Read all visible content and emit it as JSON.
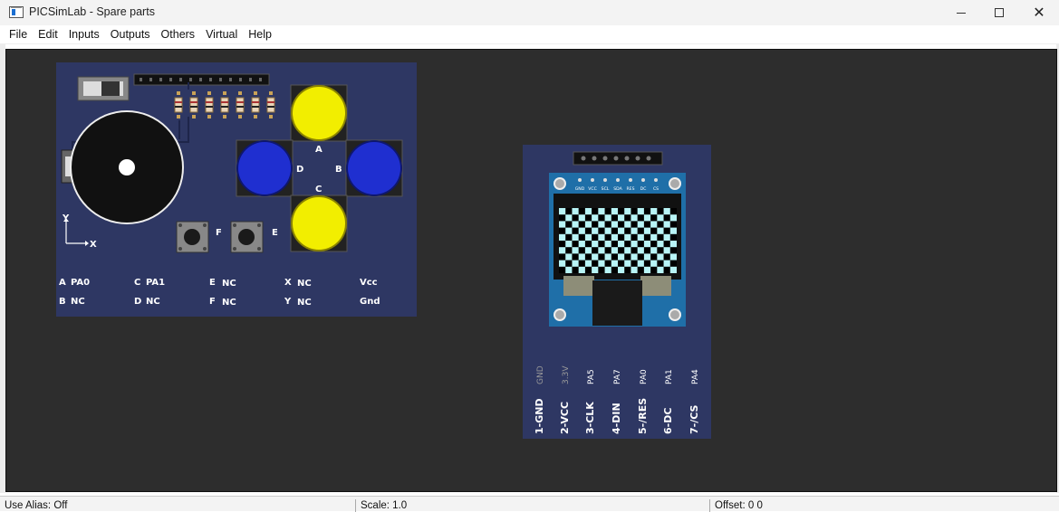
{
  "window": {
    "title": "PICSimLab - Spare parts"
  },
  "menu": {
    "items": [
      {
        "label": "File"
      },
      {
        "label": "Edit"
      },
      {
        "label": "Inputs"
      },
      {
        "label": "Outputs"
      },
      {
        "label": "Others"
      },
      {
        "label": "Virtual"
      },
      {
        "label": "Help"
      }
    ]
  },
  "gamepad": {
    "button_labels": {
      "a": "A",
      "b": "B",
      "c": "C",
      "d": "D",
      "e": "E",
      "f": "F"
    },
    "axis_labels": {
      "x": "X",
      "y": "Y"
    },
    "pin_map": [
      {
        "key": "A",
        "value": "PA0"
      },
      {
        "key": "B",
        "value": "NC"
      },
      {
        "key": "C",
        "value": "PA1"
      },
      {
        "key": "D",
        "value": "NC"
      },
      {
        "key": "E",
        "value": "NC"
      },
      {
        "key": "F",
        "value": "NC"
      },
      {
        "key": "X",
        "value": "NC"
      },
      {
        "key": "Y",
        "value": "NC"
      },
      {
        "key": "Vcc",
        "value": ""
      },
      {
        "key": "Gnd",
        "value": ""
      }
    ]
  },
  "oled": {
    "header_pins": [
      "GND",
      "VCC",
      "SCL",
      "SDA",
      "RES",
      "DC",
      "CS"
    ],
    "pins": [
      {
        "label": "1-GND",
        "conn": "GND"
      },
      {
        "label": "2-VCC",
        "conn": "3.3V"
      },
      {
        "label": "3-CLK",
        "conn": "PA5"
      },
      {
        "label": "4-DIN",
        "conn": "PA7"
      },
      {
        "label": "5-/RES",
        "conn": "PA0"
      },
      {
        "label": "6-DC",
        "conn": "PA1"
      },
      {
        "label": "7-/CS",
        "conn": "PA4"
      }
    ]
  },
  "status": {
    "alias": "Use Alias: Off",
    "scale": "Scale: 1.0",
    "offset": "Offset:  0  0"
  },
  "colors": {
    "board": "#2e3763",
    "workspace": "#2d2d2d",
    "yellow_button": "#f2ee00",
    "blue_button": "#1f2fd0",
    "oled_pixel": "#b8f4f6",
    "oled_pcb": "#1f6fa8"
  }
}
